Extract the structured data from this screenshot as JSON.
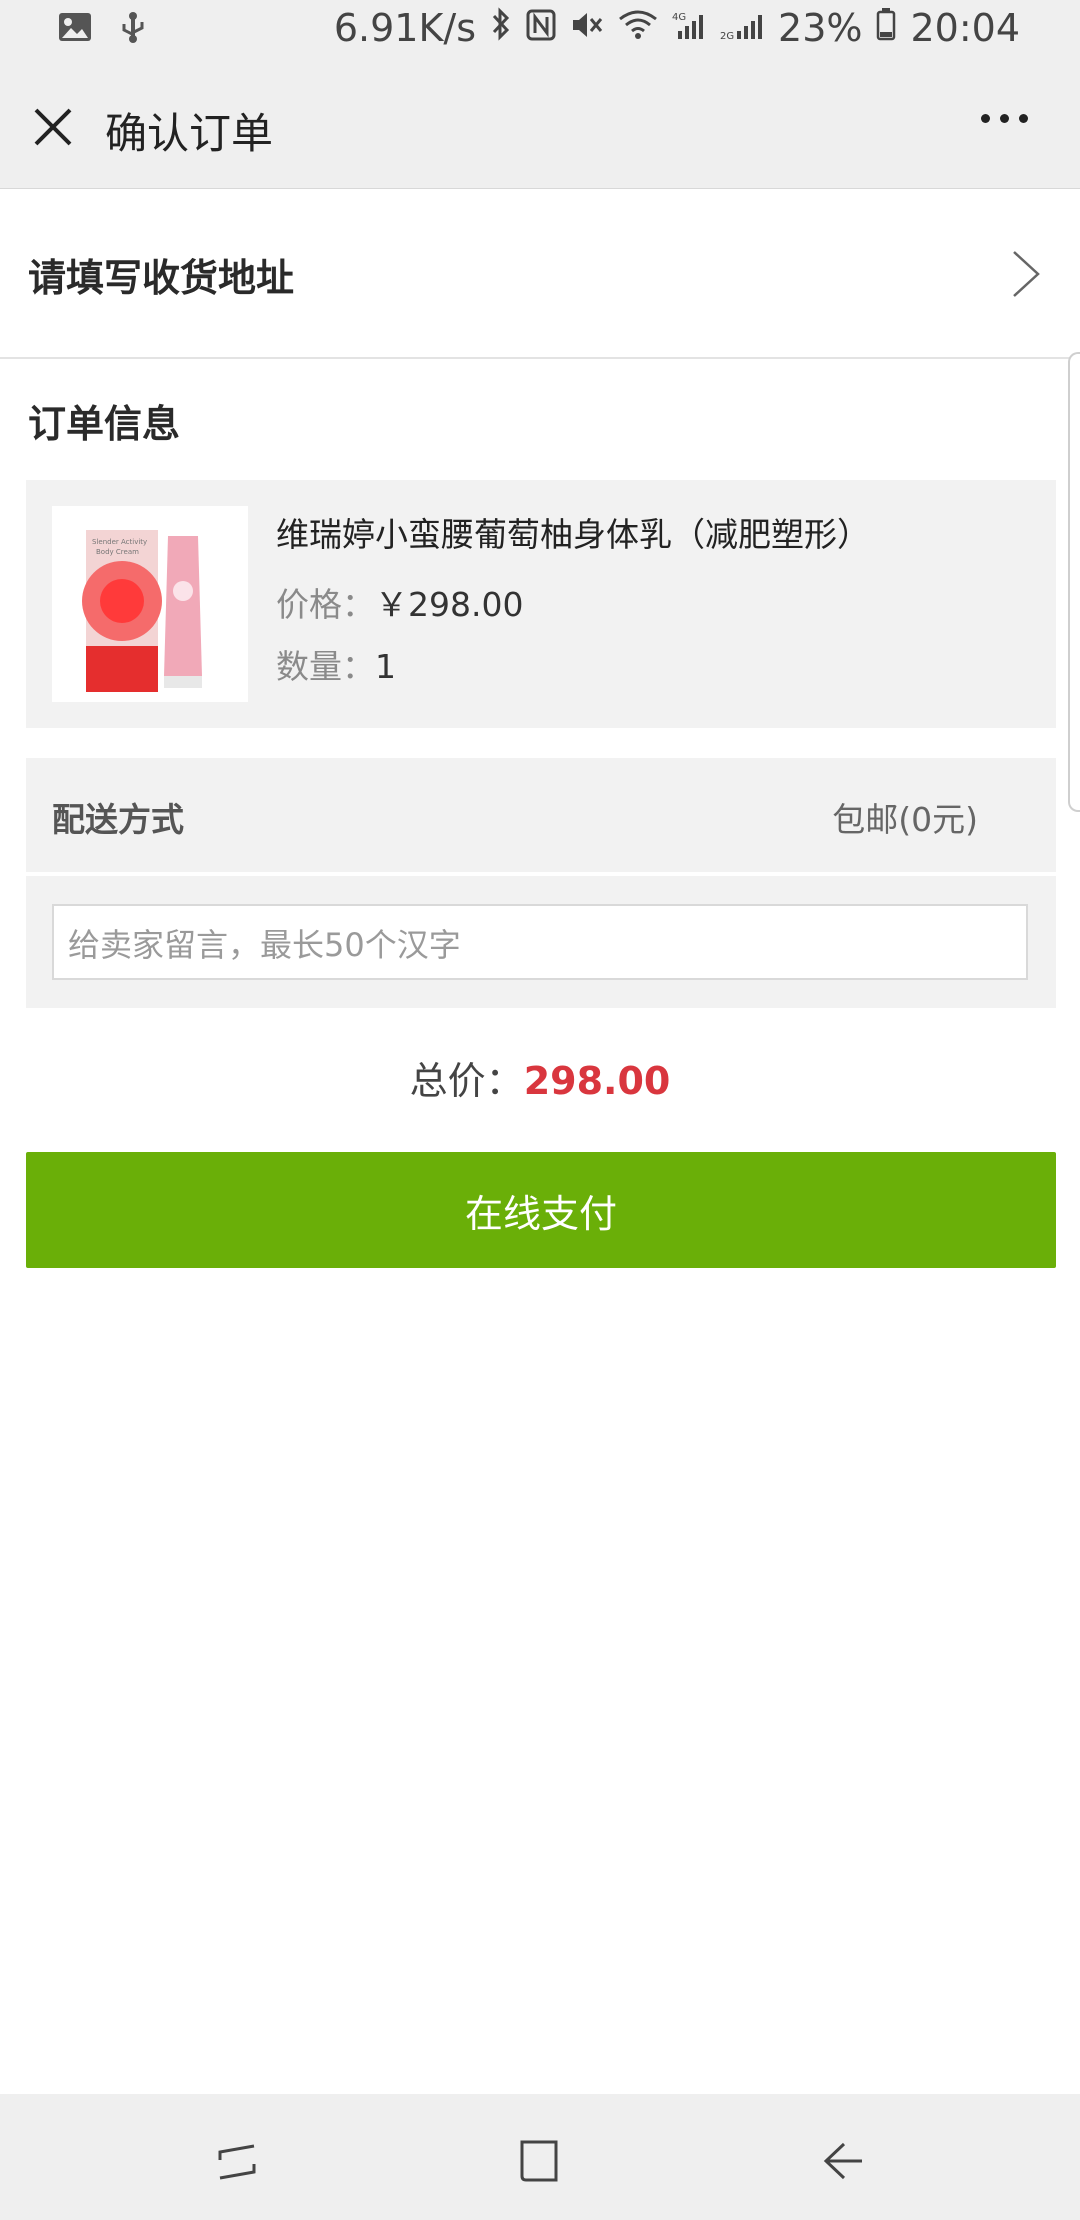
{
  "status_bar": {
    "speed": "6.91K/s",
    "battery": "23%",
    "time": "20:04",
    "icons": [
      "image-icon",
      "usb-icon",
      "bluetooth-icon",
      "nfc-icon",
      "mute-icon",
      "wifi-icon",
      "signal-4g-icon",
      "signal-2g-icon",
      "battery-icon"
    ]
  },
  "nav": {
    "title": "确认订单"
  },
  "address": {
    "prompt": "请填写收货地址"
  },
  "order": {
    "section_title": "订单信息",
    "product": {
      "name": "维瑞婷小蛮腰葡萄柚身体乳（减肥塑形）",
      "price_label": "价格：",
      "price_value": "￥298.00",
      "qty_label": "数量：",
      "qty_value": "1",
      "image_texts": [
        "Slender Activity Body Cream"
      ]
    }
  },
  "delivery": {
    "label": "配送方式",
    "value": "包邮(0元)"
  },
  "note": {
    "placeholder": "给卖家留言，最长50个汉字",
    "value": ""
  },
  "total": {
    "label": "总价：",
    "value": "298.00"
  },
  "actions": {
    "pay_label": "在线支付"
  },
  "colors": {
    "pay_button": "#6aaf08",
    "total_value": "#d9363e",
    "bar_bg": "#efefef",
    "panel_bg": "#f2f2f2"
  },
  "bottom_nav": {
    "icons": [
      "recent-apps-icon",
      "home-icon",
      "back-icon"
    ]
  }
}
